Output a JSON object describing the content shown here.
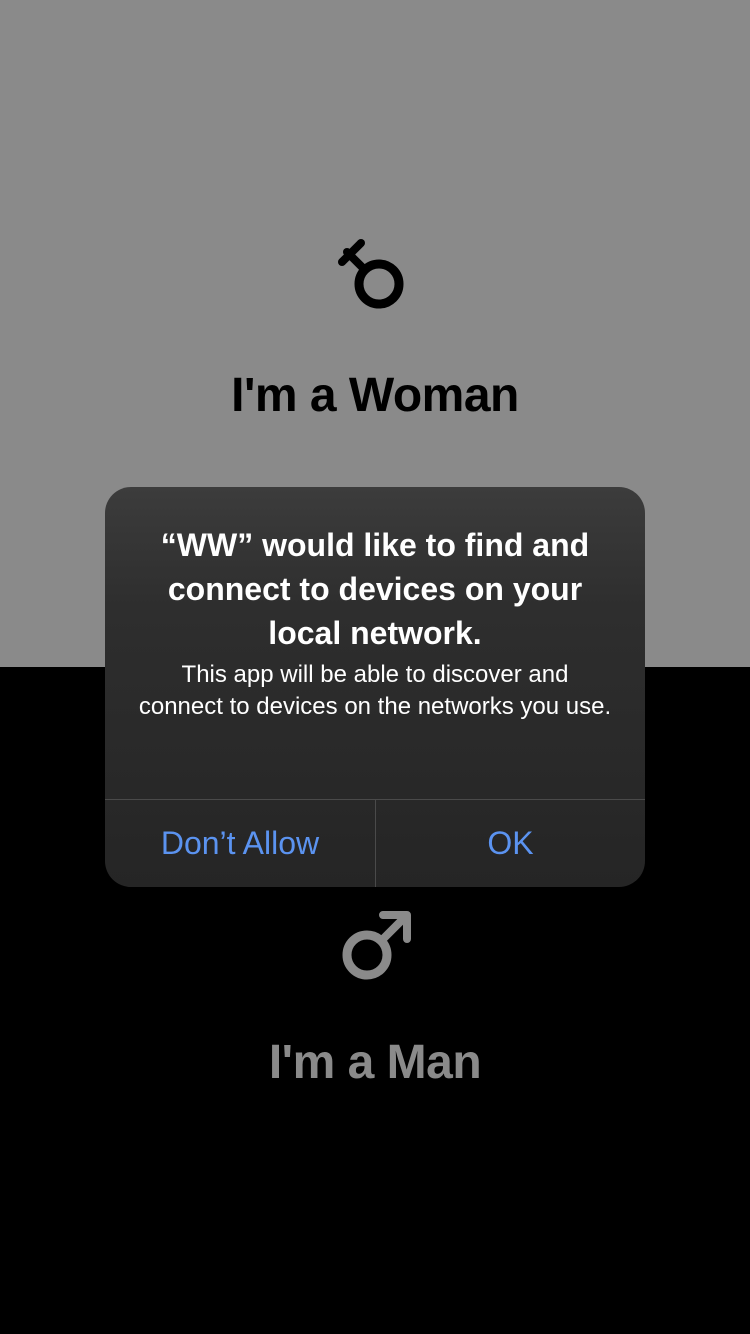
{
  "screen": {
    "top_color": "#8a8a8a",
    "bottom_color": "#000000"
  },
  "woman_option": {
    "label": "I'm a Woman",
    "icon": "female-symbol-icon"
  },
  "man_option": {
    "label": "I'm a Man",
    "icon": "male-symbol-icon"
  },
  "alert": {
    "title": "“WW” would like to find and connect to devices on your local network.",
    "message": "This app will be able to discover and connect to devices on the networks you use.",
    "buttons": {
      "deny": "Don’t Allow",
      "ok": "OK"
    },
    "button_color": "#5b93f0"
  }
}
